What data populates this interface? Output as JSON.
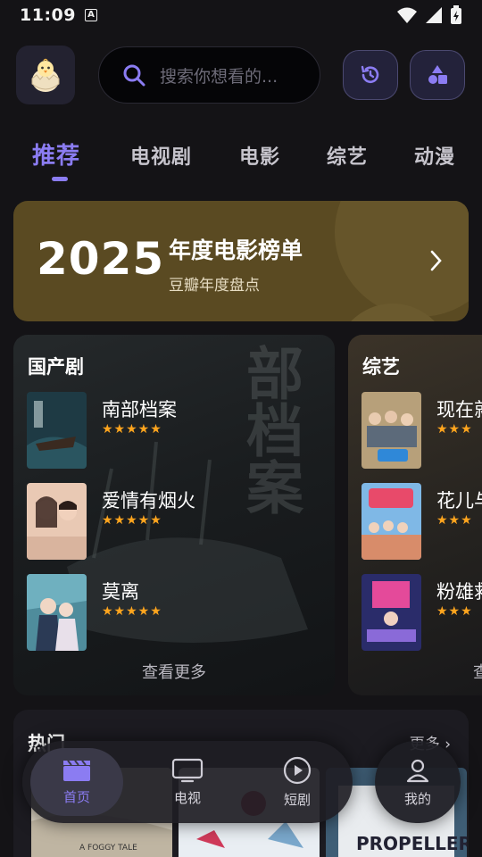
{
  "status_bar": {
    "time": "11:09",
    "badge": "A"
  },
  "header": {
    "search_placeholder": "搜索你想看的..."
  },
  "tabs": [
    {
      "label": "推荐",
      "active": true
    },
    {
      "label": "电视剧"
    },
    {
      "label": "电影"
    },
    {
      "label": "综艺"
    },
    {
      "label": "动漫"
    }
  ],
  "banner": {
    "year": "2025",
    "title": "年度电影榜单",
    "subtitle": "豆瓣年度盘点"
  },
  "tv_card": {
    "title": "国产剧",
    "items": [
      {
        "name": "南部档案",
        "stars": "★★★★★"
      },
      {
        "name": "爱情有烟火",
        "stars": "★★★★★"
      },
      {
        "name": "莫离",
        "stars": "★★★★★"
      }
    ],
    "more": "查看更多"
  },
  "variety_card": {
    "title": "综艺",
    "items": [
      {
        "name": "现在就",
        "stars": "★★★"
      },
      {
        "name": "花儿与",
        "stars": "★★★"
      },
      {
        "name": "粉雄救",
        "stars": "★★★"
      }
    ],
    "more": "查"
  },
  "hot": {
    "title": "热门",
    "more": "更多"
  },
  "nav": [
    {
      "label": "首页",
      "active": true
    },
    {
      "label": "电视"
    },
    {
      "label": "短剧"
    },
    {
      "label": "我的"
    }
  ],
  "colors": {
    "accent": "#8b7cf2",
    "star": "#ffa51e",
    "banner": "#5a4a22"
  }
}
